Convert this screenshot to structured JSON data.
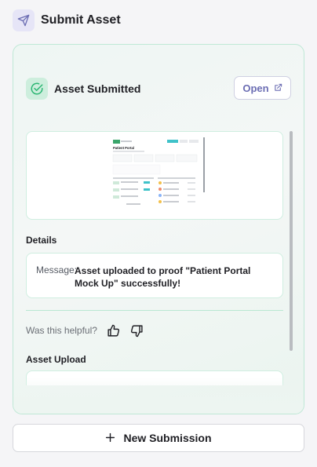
{
  "header": {
    "title": "Submit Asset",
    "icon": "send-icon"
  },
  "panel": {
    "title": "Asset Submitted",
    "status_icon": "check-circle-icon",
    "open_label": "Open",
    "open_icon": "external-link-icon"
  },
  "preview": {
    "thumbnail_title": "Patient Portal"
  },
  "details": {
    "label": "Details",
    "message_key": "Message:",
    "message_value": "Asset uploaded to proof \"Patient Portal Mock Up\" successfully!"
  },
  "feedback": {
    "prompt": "Was this helpful?",
    "up_icon": "thumbs-up-icon",
    "down_icon": "thumbs-down-icon"
  },
  "upload": {
    "label": "Asset Upload"
  },
  "footer": {
    "new_label": "New Submission",
    "plus_icon": "plus-icon"
  },
  "colors": {
    "accent": "#6b6db3",
    "success": "#2bb673",
    "panel_border": "#bfe8d6"
  }
}
